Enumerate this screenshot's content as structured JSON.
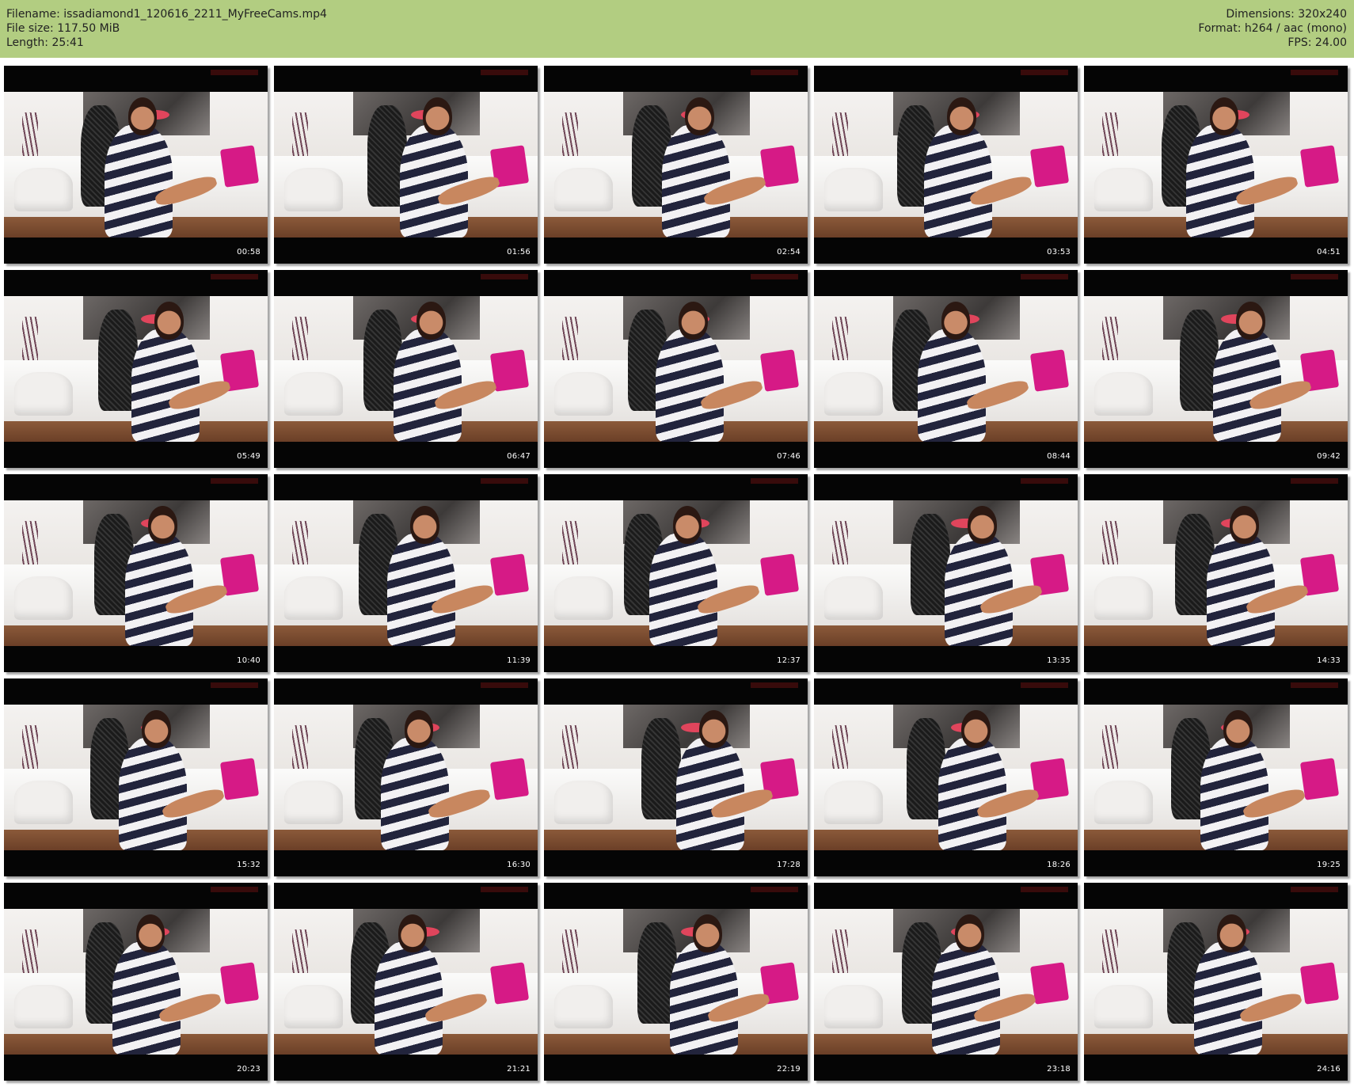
{
  "header": {
    "filename_line": "Filename: issadiamond1_120616_2211_MyFreeCams.mp4",
    "filesize_line": "File size: 117.50 MiB",
    "length_line": "Length: 25:41",
    "dimensions_line": "Dimensions: 320x240",
    "format_line": "Format: h264 / aac (mono)",
    "fps_line": "FPS: 24.00"
  },
  "colors": {
    "header_background": "#b2cd81",
    "thumbnail_border": "#050505",
    "pillow_accent": "#d61a86",
    "timestamp_text": "#ffffff"
  },
  "thumbnails": [
    {
      "time": "00:58"
    },
    {
      "time": "01:56"
    },
    {
      "time": "02:54"
    },
    {
      "time": "03:53"
    },
    {
      "time": "04:51"
    },
    {
      "time": "05:49"
    },
    {
      "time": "06:47"
    },
    {
      "time": "07:46"
    },
    {
      "time": "08:44"
    },
    {
      "time": "09:42"
    },
    {
      "time": "10:40"
    },
    {
      "time": "11:39"
    },
    {
      "time": "12:37"
    },
    {
      "time": "13:35"
    },
    {
      "time": "14:33"
    },
    {
      "time": "15:32"
    },
    {
      "time": "16:30"
    },
    {
      "time": "17:28"
    },
    {
      "time": "18:26"
    },
    {
      "time": "19:25"
    },
    {
      "time": "20:23"
    },
    {
      "time": "21:21"
    },
    {
      "time": "22:19"
    },
    {
      "time": "23:18"
    },
    {
      "time": "24:16"
    }
  ]
}
